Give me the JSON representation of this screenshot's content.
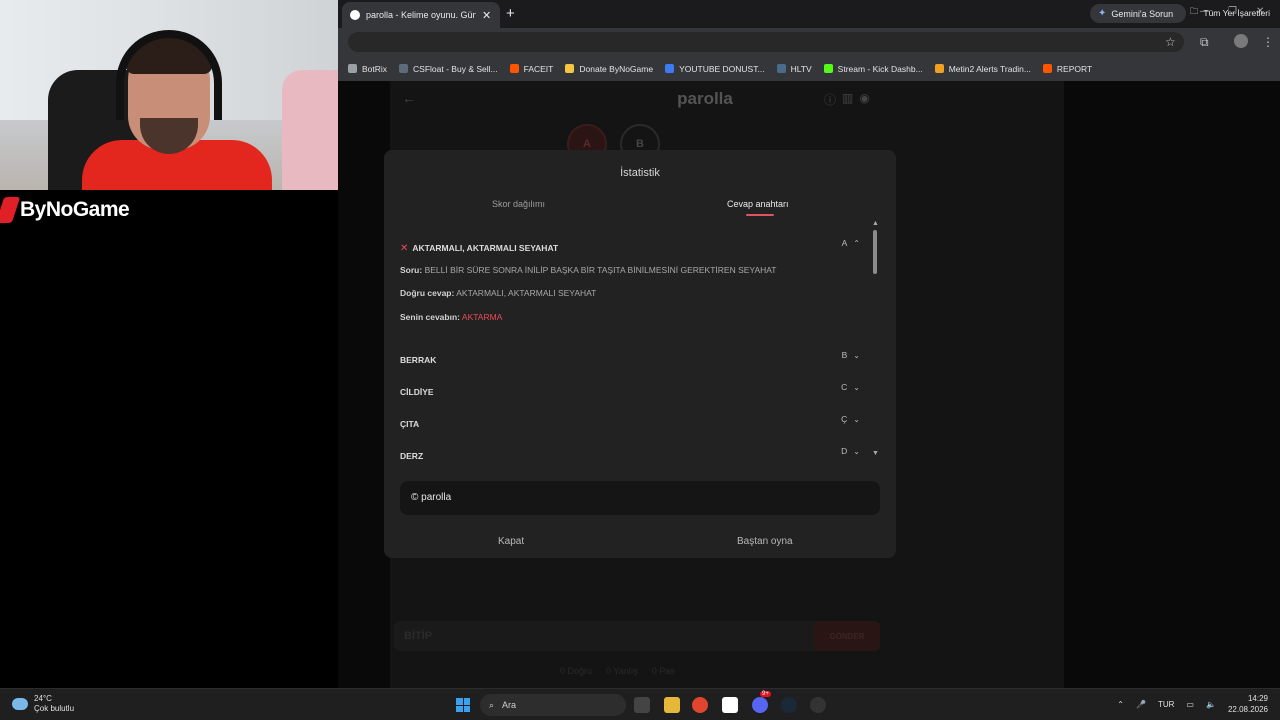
{
  "overlay": {
    "brand": "ByNoGame"
  },
  "browser": {
    "tab_title": "parolla - Kelime oyunu. Günlük",
    "new_tab": "+",
    "gemini_label": "Gemini'a Sorun",
    "bookmarks": [
      {
        "label": "BotRix",
        "color": "#9aa0a6"
      },
      {
        "label": "CSFloat - Buy & Sell...",
        "color": "#5d6b7a"
      },
      {
        "label": "FACEIT",
        "color": "#ff5500"
      },
      {
        "label": "Donate ByNoGame",
        "color": "#f5c542"
      },
      {
        "label": "YOUTUBE DONUST...",
        "color": "#3d7bf5"
      },
      {
        "label": "HLTV",
        "color": "#4a6b8a"
      },
      {
        "label": "Stream - Kick Dashb...",
        "color": "#53fc18"
      },
      {
        "label": "Metin2 Alerts Tradin...",
        "color": "#f0a020"
      },
      {
        "label": "REPORT",
        "color": "#ff5500"
      }
    ],
    "all_bookmarks": "Tüm Yer İşaretleri"
  },
  "game": {
    "title": "parolla",
    "letters": [
      "A",
      "B"
    ],
    "answer_placeholder": "BİTİP",
    "send_label": "GÖNDER",
    "stats": [
      "0 Doğru",
      "0 Yanlış",
      "0 Pas"
    ]
  },
  "modal": {
    "title": "İstatistik",
    "tabs": [
      "Skor dağılımı",
      "Cevap anahtarı"
    ],
    "active_tab": "Cevap anahtarı",
    "expanded": {
      "word": "AKTARMALI, AKTARMALI SEYAHAT",
      "letter": "A",
      "question_label": "Soru:",
      "question": "BELLİ BİR SÜRE SONRA İNİLİP BAŞKA BİR TAŞITA BİNİLMESİNİ GEREKTİREN SEYAHAT",
      "correct_label": "Doğru cevap:",
      "correct": "AKTARMALI, AKTARMALI SEYAHAT",
      "yours_label": "Senin cevabın:",
      "yours": "AKTARMA"
    },
    "rows": [
      {
        "word": "BERRAK",
        "letter": "B"
      },
      {
        "word": "CİLDİYE",
        "letter": "C"
      },
      {
        "word": "ÇITA",
        "letter": "Ç"
      },
      {
        "word": "DERZ",
        "letter": "D"
      }
    ],
    "footer": "© parolla",
    "close_label": "Kapat",
    "restart_label": "Baştan oyna"
  },
  "taskbar": {
    "temp": "24°C",
    "weather": "Çok bulutlu",
    "search_placeholder": "Ara",
    "lang": "TUR",
    "time": "14:29",
    "date": "22.08.2026",
    "notification_count": "9+"
  }
}
